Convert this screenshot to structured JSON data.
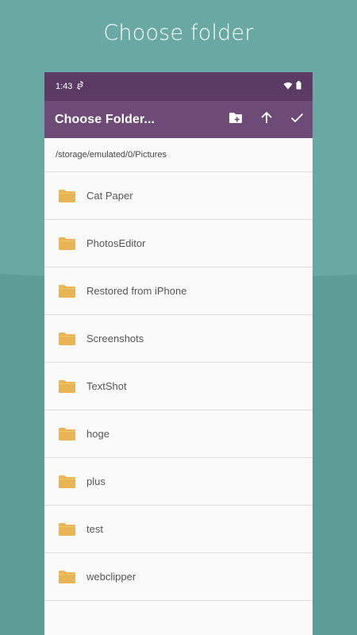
{
  "promo": {
    "title": "Choose folder"
  },
  "status_bar": {
    "time": "1:43"
  },
  "app_bar": {
    "title": "Choose Folder...",
    "actions": [
      {
        "icon": "new-folder-icon"
      },
      {
        "icon": "arrow-up-icon"
      },
      {
        "icon": "check-icon"
      }
    ]
  },
  "path": "/storage/emulated/0/Pictures",
  "folders": [
    {
      "label": "Cat Paper",
      "icon": "folder-icon"
    },
    {
      "label": "PhotosEditor",
      "icon": "folder-icon"
    },
    {
      "label": "Restored from iPhone",
      "icon": "folder-icon"
    },
    {
      "label": "Screenshots",
      "icon": "folder-icon"
    },
    {
      "label": "TextShot",
      "icon": "folder-icon"
    },
    {
      "label": "hoge",
      "icon": "folder-icon"
    },
    {
      "label": "plus",
      "icon": "folder-icon"
    },
    {
      "label": "test",
      "icon": "folder-icon"
    },
    {
      "label": "webclipper",
      "icon": "folder-icon"
    }
  ],
  "colors": {
    "background": "#6aa9a3",
    "background_lower": "#5e9d97",
    "status_bar": "#5b3a63",
    "app_bar": "#6e4a77",
    "folder": "#e8b454",
    "list_background": "#fafafa"
  }
}
